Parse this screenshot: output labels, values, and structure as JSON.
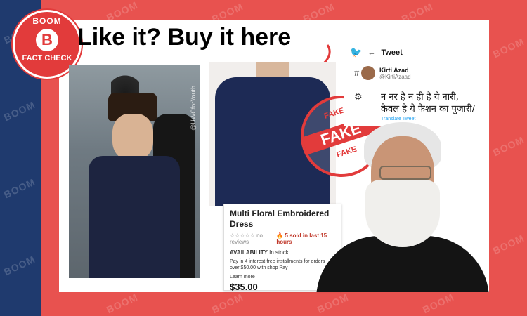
{
  "logo": {
    "top": "BOOM",
    "bottom": "FACT CHECK",
    "mark": "B"
  },
  "watermark": "BOOM",
  "headline": "Like it? Buy it here",
  "photo1": {
    "handle": "@UWCforYouth"
  },
  "stamp": {
    "top": "FAKE",
    "main": "FAKE",
    "bottom": "FAKE"
  },
  "product": {
    "title": "Multi Floral Embroidered Dress",
    "reviews": "no reviews",
    "sold": "5 sold in last 15 hours",
    "availability_label": "AVAILABILITY",
    "availability_value": "In stock",
    "payment": "Pay in 4 interest-free installments for orders over $50.00 with shop Pay",
    "learn_more": "Learn more",
    "price": "$35.00"
  },
  "tweet": {
    "header": "Tweet",
    "name": "Kirti Azad",
    "handle": "@KirtiAzaad",
    "text_line1": "न नर है न ही है ये नारी,",
    "text_line2": "केवल है ये फैशन का पुजारी/",
    "translate": "Translate Tweet"
  },
  "colors": {
    "brand_red": "#e23b3b",
    "navy": "#1f3a6e",
    "background": "#e8524f",
    "twitter_blue": "#1da1f2"
  }
}
